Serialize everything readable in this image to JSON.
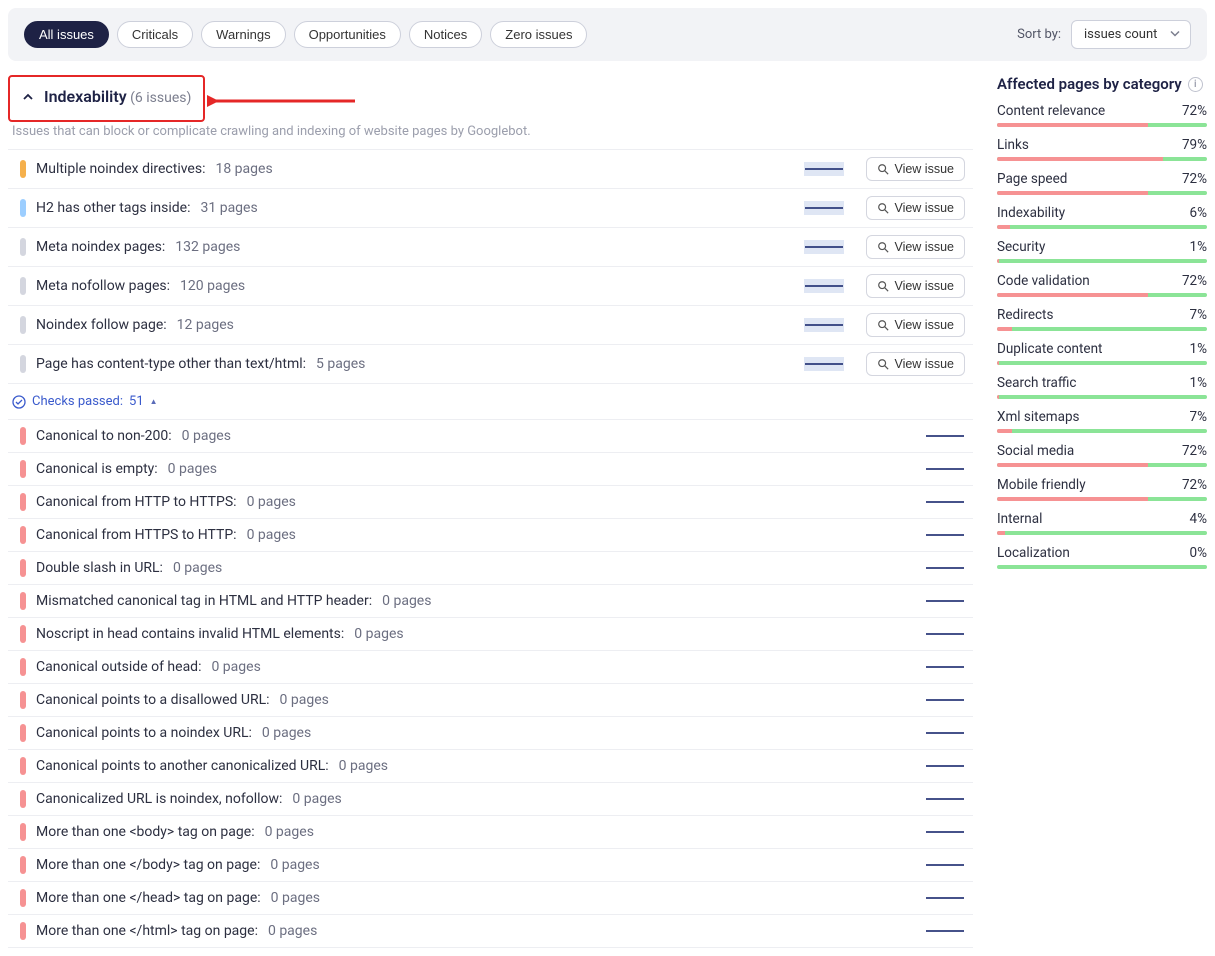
{
  "topbar": {
    "filters": [
      {
        "label": "All issues",
        "active": true
      },
      {
        "label": "Criticals",
        "active": false
      },
      {
        "label": "Warnings",
        "active": false
      },
      {
        "label": "Opportunities",
        "active": false
      },
      {
        "label": "Notices",
        "active": false
      },
      {
        "label": "Zero issues",
        "active": false
      }
    ],
    "sort_label": "Sort by:",
    "sort_value": "issues count"
  },
  "section": {
    "title": "Indexability",
    "count_label": "(6 issues)",
    "description": "Issues that can block or complicate crawling and indexing of website pages by Googlebot."
  },
  "issues_active": [
    {
      "sev": "orange",
      "label": "Multiple noindex directives:",
      "pages": "18 pages",
      "bar": "filled",
      "btn": true
    },
    {
      "sev": "blue",
      "label": "H2 has other tags inside:",
      "pages": "31 pages",
      "bar": "filled",
      "btn": true
    },
    {
      "sev": "grey",
      "label": "Meta noindex pages:",
      "pages": "132 pages",
      "bar": "filled",
      "btn": true
    },
    {
      "sev": "grey",
      "label": "Meta nofollow pages:",
      "pages": "120 pages",
      "bar": "filled",
      "btn": true
    },
    {
      "sev": "grey",
      "label": "Noindex follow page:",
      "pages": "12 pages",
      "bar": "filled",
      "btn": true
    },
    {
      "sev": "grey",
      "label": "Page has content-type other than text/html:",
      "pages": "5 pages",
      "bar": "filled",
      "btn": true
    }
  ],
  "checks_passed": {
    "prefix": "Checks passed:",
    "count": "51"
  },
  "issues_passed": [
    {
      "sev": "red",
      "label": "Canonical to non-200:",
      "pages": "0 pages"
    },
    {
      "sev": "red",
      "label": "Canonical is empty:",
      "pages": "0 pages"
    },
    {
      "sev": "red",
      "label": "Canonical from HTTP to HTTPS:",
      "pages": "0 pages"
    },
    {
      "sev": "red",
      "label": "Canonical from HTTPS to HTTP:",
      "pages": "0 pages"
    },
    {
      "sev": "red",
      "label": "Double slash in URL:",
      "pages": "0 pages"
    },
    {
      "sev": "red",
      "label": "Mismatched canonical tag in HTML and HTTP header:",
      "pages": "0 pages"
    },
    {
      "sev": "red",
      "label": "Noscript in head contains invalid HTML elements:",
      "pages": "0 pages"
    },
    {
      "sev": "red",
      "label": "Canonical outside of head:",
      "pages": "0 pages"
    },
    {
      "sev": "red",
      "label": "Canonical points to a disallowed URL:",
      "pages": "0 pages"
    },
    {
      "sev": "red",
      "label": "Canonical points to a noindex URL:",
      "pages": "0 pages"
    },
    {
      "sev": "red",
      "label": "Canonical points to another canonicalized URL:",
      "pages": "0 pages"
    },
    {
      "sev": "red",
      "label": "Canonicalized URL is noindex, nofollow:",
      "pages": "0 pages"
    },
    {
      "sev": "red",
      "label": "More than one <body> tag on page:",
      "pages": "0 pages"
    },
    {
      "sev": "red",
      "label": "More than one </body> tag on page:",
      "pages": "0 pages"
    },
    {
      "sev": "red",
      "label": "More than one </head> tag on page:",
      "pages": "0 pages"
    },
    {
      "sev": "red",
      "label": "More than one </html> tag on page:",
      "pages": "0 pages"
    }
  ],
  "view_issue_label": "View issue",
  "sidebar": {
    "title": "Affected pages by category",
    "categories": [
      {
        "name": "Content relevance",
        "pct": "72%",
        "fill": 72
      },
      {
        "name": "Links",
        "pct": "79%",
        "fill": 79
      },
      {
        "name": "Page speed",
        "pct": "72%",
        "fill": 72
      },
      {
        "name": "Indexability",
        "pct": "6%",
        "fill": 6
      },
      {
        "name": "Security",
        "pct": "1%",
        "fill": 1
      },
      {
        "name": "Code validation",
        "pct": "72%",
        "fill": 72
      },
      {
        "name": "Redirects",
        "pct": "7%",
        "fill": 7
      },
      {
        "name": "Duplicate content",
        "pct": "1%",
        "fill": 1
      },
      {
        "name": "Search traffic",
        "pct": "1%",
        "fill": 1
      },
      {
        "name": "Xml sitemaps",
        "pct": "7%",
        "fill": 7
      },
      {
        "name": "Social media",
        "pct": "72%",
        "fill": 72
      },
      {
        "name": "Mobile friendly",
        "pct": "72%",
        "fill": 72
      },
      {
        "name": "Internal",
        "pct": "4%",
        "fill": 4
      },
      {
        "name": "Localization",
        "pct": "0%",
        "fill": 0
      }
    ]
  }
}
